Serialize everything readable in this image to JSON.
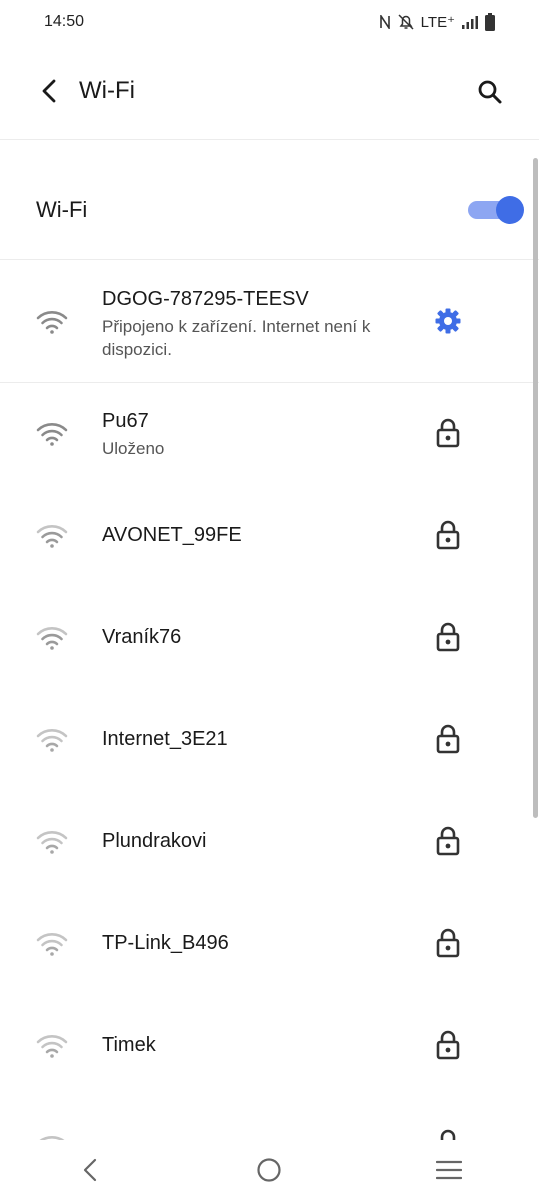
{
  "status_bar": {
    "time": "14:50",
    "network": "LTE⁺",
    "icons": [
      "nfc-icon",
      "mute-icon",
      "signal-icon",
      "battery-icon"
    ]
  },
  "app_bar": {
    "title": "Wi-Fi",
    "back_icon": "back-arrow-icon",
    "search_icon": "search-icon"
  },
  "wifi_toggle": {
    "label": "Wi-Fi",
    "state": "on",
    "accent": "#3f6de6"
  },
  "networks": [
    {
      "name": "DGOG-787295-TEESV",
      "status": "Připojeno k zařízení. Internet není k dispozici.",
      "action_icon": "gear-icon",
      "signal": 3
    },
    {
      "name": "Pu67",
      "status": "Uloženo",
      "action_icon": "lock-icon",
      "signal": 3
    },
    {
      "name": "AVONET_99FE",
      "status": "",
      "action_icon": "lock-icon",
      "signal": 2
    },
    {
      "name": "Vraník76",
      "status": "",
      "action_icon": "lock-icon",
      "signal": 2
    },
    {
      "name": "Internet_3E21",
      "status": "",
      "action_icon": "lock-icon",
      "signal": 1
    },
    {
      "name": "Plundrakovi",
      "status": "",
      "action_icon": "lock-icon",
      "signal": 1
    },
    {
      "name": "TP-Link_B496",
      "status": "",
      "action_icon": "lock-icon",
      "signal": 1
    },
    {
      "name": "Timek",
      "status": "",
      "action_icon": "lock-icon",
      "signal": 1
    }
  ],
  "nav_bar": {
    "back": "nav-back-icon",
    "home": "nav-home-icon",
    "recents": "nav-recents-icon"
  },
  "colors": {
    "accent": "#3f6de6",
    "icon_dark": "#333333",
    "wifi_strong": "#8a8a8a",
    "wifi_weak": "#c4c4c4"
  }
}
